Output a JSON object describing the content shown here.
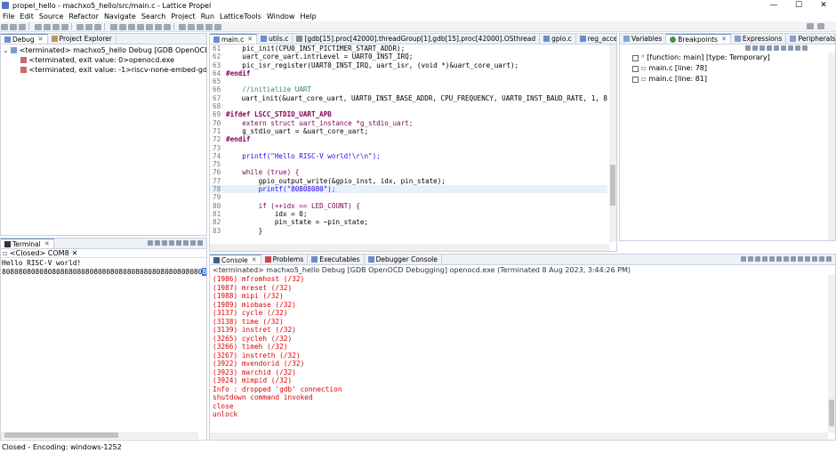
{
  "window": {
    "title": "propel_hello - machxo5_hello/src/main.c - Lattice Propel",
    "minimize": "—",
    "maximize": "☐",
    "close": "✕"
  },
  "menu": [
    "File",
    "Edit",
    "Source",
    "Refactor",
    "Navigate",
    "Search",
    "Project",
    "Run",
    "LatticeTools",
    "Window",
    "Help"
  ],
  "debug": {
    "tabs": [
      {
        "label": "Debug"
      },
      {
        "label": "Project Explorer"
      }
    ],
    "items": [
      {
        "text": "<terminated> machxo5_hello Debug [GDB OpenOCD Debugging]"
      },
      {
        "text": "<terminated, exit value: 0>openocd.exe"
      },
      {
        "text": "<terminated, exit value: -1>riscv-none-embed-gdb"
      }
    ]
  },
  "editor": {
    "tabs": [
      "main.c",
      "utils.c",
      "[gdb[15].proc[42000].threadGroup[1],gdb[15].proc[42000].OSthread",
      "gpio.c",
      "reg_access.c"
    ],
    "overflow": "»",
    "lines": [
      {
        "n": "61",
        "html": "    pic_init(CPU0_INST_PICTIMER_START_ADDR);"
      },
      {
        "n": "62",
        "html": "    uart_core_uart.<i>intrLevel</i> = UART0_INST_IRQ;"
      },
      {
        "n": "63",
        "html": "    pic_isr_register(UART0_INST_IRQ, uart_isr, (void *)&uart_core_uart);"
      },
      {
        "n": "64",
        "html": "<b>#endif</b>"
      },
      {
        "n": "65",
        "html": ""
      },
      {
        "n": "66",
        "html": "    //initialize UART"
      },
      {
        "n": "67",
        "html": "    uart_init(&uart_core_uart, UART0_INST_BASE_ADDR, CPU_FREQUENCY, UART0_INST_BAUD_RATE, 1, 8"
      },
      {
        "n": "68",
        "html": ""
      },
      {
        "n": "69",
        "html": "#ifdef LSCC_STDIO_UART_APB"
      },
      {
        "n": "70",
        "html": "    extern struct uart_instance *g_stdio_uart;"
      },
      {
        "n": "71",
        "html": "    g_stdio_uart = &uart_core_uart;"
      },
      {
        "n": "72",
        "html": "#endif"
      },
      {
        "n": "73",
        "html": ""
      },
      {
        "n": "74",
        "html": "    printf(\"Hello RISC-V world!\\r\\n\");"
      },
      {
        "n": "75",
        "html": ""
      },
      {
        "n": "76",
        "html": "    while (true) {"
      },
      {
        "n": "77",
        "html": "        gpio_output_write(&gpio_inst, idx, pin_state);"
      },
      {
        "n": "78",
        "html": "        printf(\"80808080\");"
      },
      {
        "n": "79",
        "html": ""
      },
      {
        "n": "80",
        "html": "        if (++idx == LED_COUNT) {"
      },
      {
        "n": "81",
        "html": "            idx = 0;"
      },
      {
        "n": "82",
        "html": "            pin_state = ~pin_state;"
      },
      {
        "n": "83",
        "html": "        }"
      }
    ]
  },
  "right": {
    "tabs": [
      "Variables",
      "Breakpoints",
      "Expressions",
      "Peripherals"
    ],
    "items": [
      "[function: main] [type: Temporary]",
      "main.c [line: 78]",
      "main.c [line: 81]"
    ]
  },
  "terminal": {
    "tab": "Terminal",
    "header": "<Closed> COM8",
    "line1": "Hello RISC-V world!",
    "line2": "808080808080808080808080808080808080808080808080",
    "selected": "80808080"
  },
  "console": {
    "tabs": [
      "Console",
      "Problems",
      "Executables",
      "Debugger Console"
    ],
    "header": "<terminated> machxo5_hello Debug [GDB OpenOCD Debugging] openocd.exe (Terminated 8 Aug 2023, 3:44:26 PM)",
    "lines": [
      "(1986) mfromhost (/32)",
      "(1987) mreset (/32)",
      "(1988) mipi (/32)",
      "(1989) miobase (/32)",
      "(3137) cycle (/32)",
      "(3138) time (/32)",
      "(3139) instret (/32)",
      "(3265) cycleh (/32)",
      "(3266) timeh (/32)",
      "(3267) instreth (/32)",
      "(3922) mvendorid (/32)",
      "(3923) marchid (/32)",
      "(3924) mimpid (/32)",
      "Info : dropped 'gdb' connection",
      "shutdown command invoked",
      "close",
      "unlock"
    ]
  },
  "status": {
    "text": "Closed - Encoding: windows-1252"
  }
}
